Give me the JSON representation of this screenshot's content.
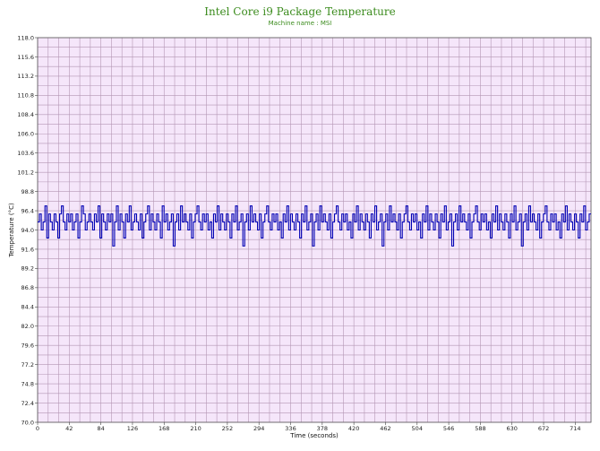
{
  "chart_data": {
    "type": "line",
    "title": "Intel Core i9 Package Temperature",
    "subtitle": "Machine name : MSI",
    "xlabel": "Time (seconds)",
    "ylabel": "Temperature (°C)",
    "xlim": [
      0,
      735
    ],
    "ylim": [
      70.0,
      118.0
    ],
    "x_ticks": [
      0,
      42,
      84,
      126,
      168,
      210,
      252,
      294,
      336,
      378,
      420,
      462,
      504,
      546,
      588,
      630,
      672,
      714
    ],
    "y_ticks": [
      "70.0",
      "72.4",
      "74.8",
      "77.2",
      "79.6",
      "82.0",
      "84.4",
      "86.8",
      "89.2",
      "91.6",
      "94.0",
      "96.4",
      "98.8",
      "101.2",
      "103.6",
      "106.0",
      "108.4",
      "110.8",
      "113.2",
      "115.6",
      "118.0"
    ],
    "grid": true,
    "plot_background": "#f5e6fa",
    "grid_color": "#b496b4",
    "line_color": "#0000b4",
    "title_color": "#3c8c1e",
    "series": [
      {
        "values": [
          95,
          96,
          94,
          95,
          97,
          93,
          96,
          95,
          94,
          96,
          95,
          93,
          96,
          97,
          95,
          94,
          96,
          95,
          96,
          94,
          95,
          96,
          93,
          95,
          97,
          96,
          94,
          95,
          96,
          95,
          94,
          96,
          95,
          97,
          93,
          96,
          95,
          94,
          96,
          95,
          96,
          92,
          95,
          97,
          94,
          96,
          95,
          93,
          96,
          95,
          97,
          94,
          95,
          96,
          95,
          94,
          96,
          93,
          95,
          96,
          97,
          94,
          96,
          95,
          94,
          96,
          95,
          93,
          97,
          95,
          96,
          94,
          95,
          96,
          92,
          95,
          96,
          94,
          97,
          95,
          96,
          95,
          94,
          96,
          93,
          95,
          96,
          97,
          95,
          94,
          96,
          95,
          96,
          94,
          95,
          93,
          96,
          95,
          97,
          94,
          96,
          95,
          94,
          96,
          95,
          93,
          96,
          95,
          97,
          94,
          95,
          96,
          92,
          95,
          96,
          94,
          97,
          95,
          96,
          95,
          94,
          96,
          93,
          95,
          96,
          97,
          95,
          94,
          96,
          95,
          96,
          94,
          95,
          93,
          96,
          95,
          97,
          94,
          96,
          95,
          94,
          96,
          95,
          93,
          96,
          95,
          97,
          94,
          95,
          96,
          92,
          95,
          96,
          94,
          97,
          95,
          96,
          95,
          94,
          96,
          93,
          95,
          96,
          97,
          95,
          94,
          96,
          95,
          96,
          94,
          95,
          93,
          96,
          95,
          97,
          94,
          96,
          95,
          94,
          96,
          95,
          93,
          96,
          95,
          97,
          94,
          95,
          96,
          92,
          95,
          96,
          94,
          97,
          95,
          96,
          95,
          94,
          96,
          93,
          95,
          96,
          97,
          95,
          94,
          96,
          95,
          96,
          94,
          95,
          93,
          96,
          95,
          97,
          94,
          96,
          95,
          94,
          96,
          95,
          93,
          96,
          95,
          97,
          94,
          95,
          96,
          92,
          95,
          96,
          94,
          97,
          95,
          96,
          95,
          94,
          96,
          93,
          95,
          96,
          97,
          95,
          94,
          96,
          95,
          96,
          94,
          95,
          93,
          96,
          95,
          97,
          94,
          96,
          95,
          94,
          96,
          95,
          93,
          96,
          95,
          97,
          94,
          95,
          96,
          92,
          95,
          96,
          94,
          97,
          95,
          96,
          95,
          94,
          96,
          93,
          95,
          96,
          97,
          95,
          94,
          96,
          95,
          96,
          94,
          95,
          93,
          96,
          95,
          97,
          94,
          96,
          95,
          94,
          96,
          95,
          93,
          96,
          95,
          97,
          94,
          95,
          96
        ]
      }
    ]
  }
}
